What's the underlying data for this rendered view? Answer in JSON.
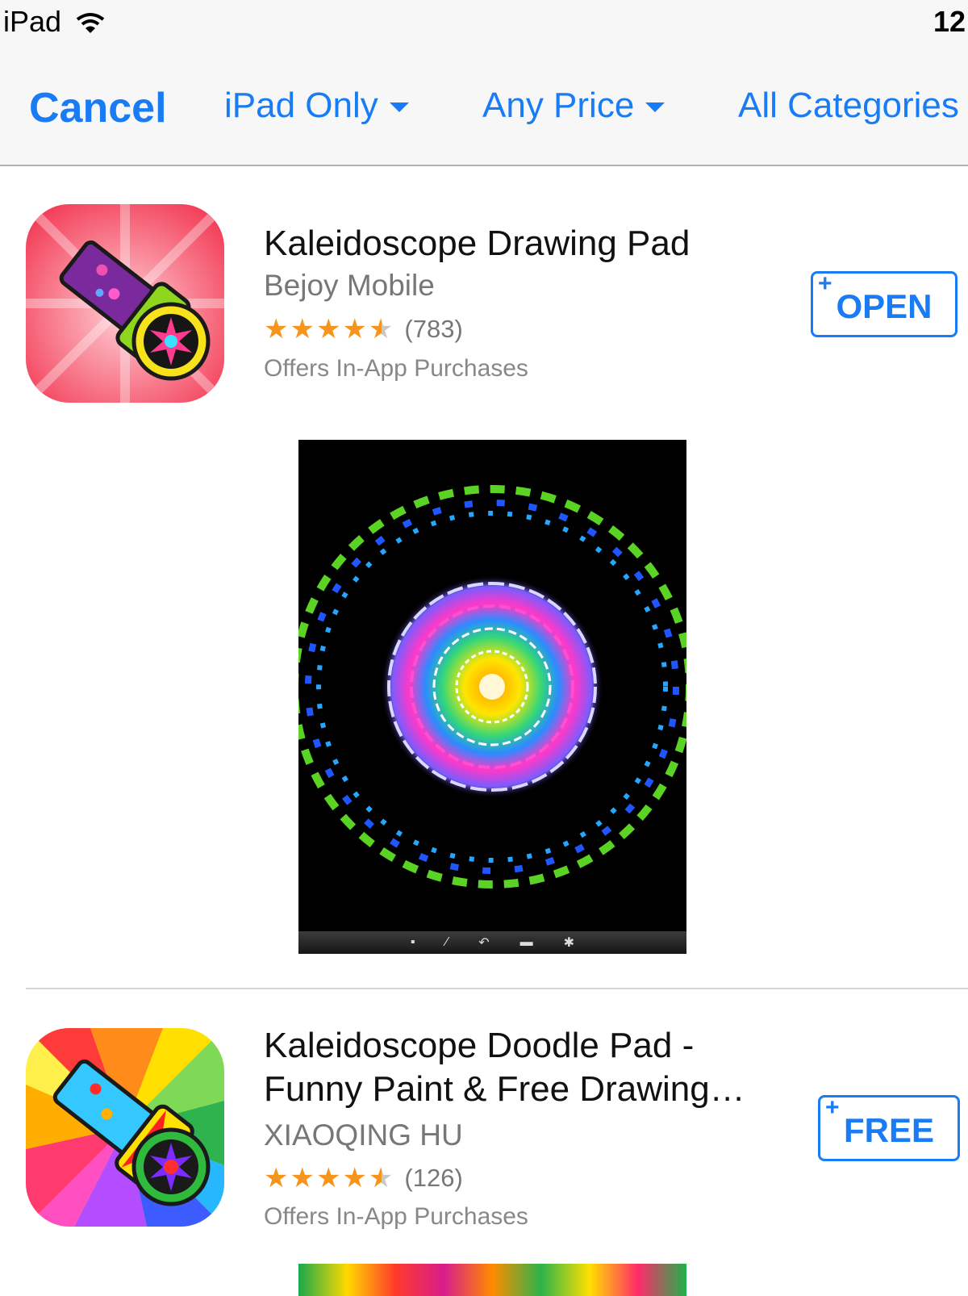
{
  "status_bar": {
    "device": "iPad",
    "time": "12:"
  },
  "filter_bar": {
    "cancel": "Cancel",
    "filters": [
      "iPad Only",
      "Any Price",
      "All Categories"
    ]
  },
  "apps": [
    {
      "title": "Kaleidoscope Drawing Pad",
      "developer": "Bejoy Mobile",
      "stars": 4.5,
      "rating_count": "(783)",
      "iap": "Offers In-App Purchases",
      "button_plus": "+",
      "button": "OPEN",
      "icon": "kaleidoscope-purple-icon"
    },
    {
      "title_line1": "Kaleidoscope Doodle Pad -",
      "title_line2": "Funny Paint & Free Drawing…",
      "developer": "XIAOQING HU",
      "stars": 4.5,
      "rating_count": "(126)",
      "iap": "Offers In-App Purchases",
      "button_plus": "+",
      "button": "FREE",
      "icon": "kaleidoscope-rainbow-icon"
    }
  ],
  "colors": {
    "accent": "#1a7cf5",
    "star": "#f7941d"
  }
}
